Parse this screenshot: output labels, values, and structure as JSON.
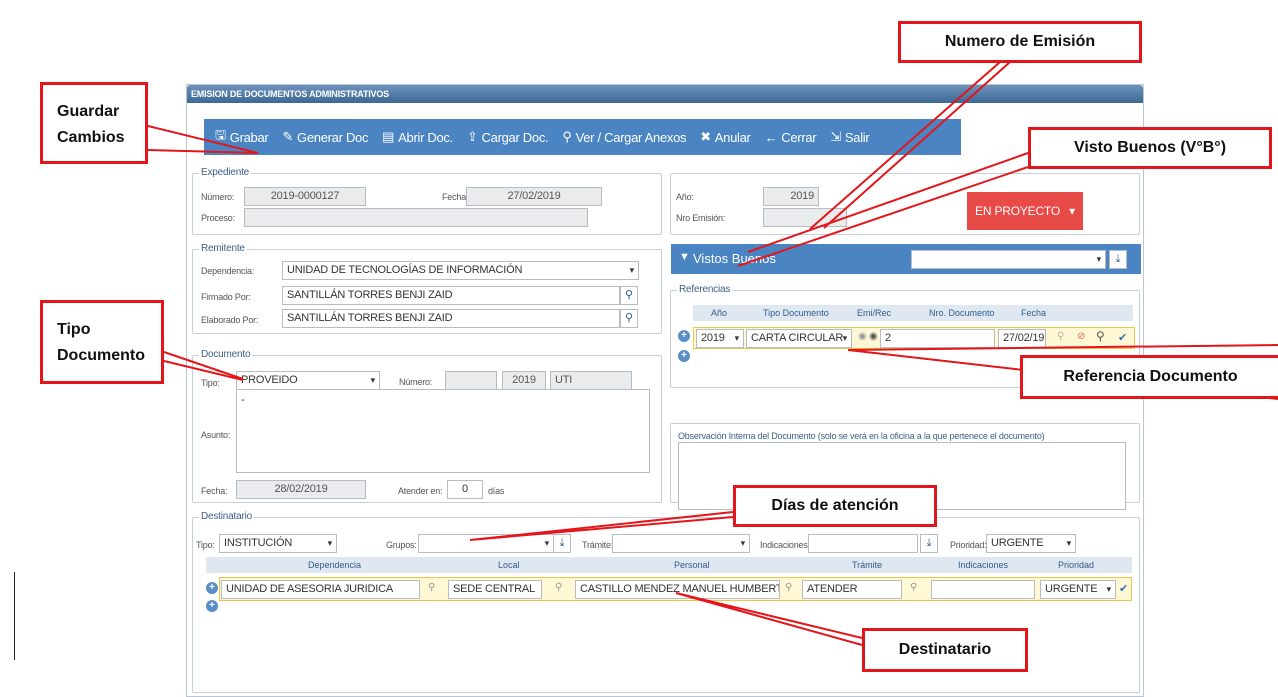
{
  "window_title": "EMISION DE DOCUMENTOS ADMINISTRATIVOS",
  "toolbar": [
    {
      "icon": "save-icon",
      "glyph": "🖫",
      "label": "Grabar"
    },
    {
      "icon": "edit-icon",
      "glyph": "✎",
      "label": "Generar Doc"
    },
    {
      "icon": "document-icon",
      "glyph": "▤",
      "label": "Abrir Doc."
    },
    {
      "icon": "upload-icon",
      "glyph": "⇪",
      "label": "Cargar Doc."
    },
    {
      "icon": "paperclip-icon",
      "glyph": "⚲",
      "label": "Ver / Cargar Anexos"
    },
    {
      "icon": "close-icon",
      "glyph": "✖",
      "label": "Anular"
    },
    {
      "icon": "arrow-left-icon",
      "glyph": "←",
      "label": "Cerrar"
    },
    {
      "icon": "exit-icon",
      "glyph": "⇲",
      "label": "Salir"
    }
  ],
  "expediente": {
    "legend": "Expediente",
    "numero_label": "Número:",
    "numero": "2019-0000127",
    "fecha_label": "Fecha:",
    "fecha": "27/02/2019",
    "proceso_label": "Proceso:",
    "proceso": ""
  },
  "emision": {
    "anio_label": "Año:",
    "anio": "2019",
    "nro_label": "Nro Emisión:",
    "nro": "",
    "estado": "EN PROYECTO"
  },
  "remitente": {
    "legend": "Remitente",
    "dependencia_label": "Dependencia:",
    "dependencia": "UNIDAD DE TECNOLOGÍAS DE INFORMACIÓN",
    "firmado_label": "Firmado Por:",
    "firmado": "SANTILLÁN TORRES BENJI ZAID",
    "elaborado_label": "Elaborado Por:",
    "elaborado": "SANTILLÁN TORRES BENJI ZAID"
  },
  "vistos": {
    "label": "Vistos Buenos",
    "value": ""
  },
  "referencias": {
    "legend": "Referencias",
    "headers": [
      "Año",
      "Tipo Documento",
      "Emi/Rec",
      "Nro. Documento",
      "Fecha"
    ],
    "row": {
      "anio": "2019",
      "tipo": "CARTA CIRCULAR",
      "nro": "2",
      "fecha": "27/02/19"
    }
  },
  "documento": {
    "legend": "Documento",
    "tipo_label": "Tipo:",
    "tipo": "PROVEIDO",
    "numero_label": "Número:",
    "numero": "",
    "anio": "2019",
    "sigla": "UTI",
    "asunto_label": "Asunto:",
    "asunto": "-",
    "fecha_label": "Fecha:",
    "fecha": "28/02/2019",
    "atender_label": "Atender en:",
    "atender": "0",
    "dias_label": "días"
  },
  "observacion": {
    "label": "Observación Interna del Documento (solo se verá en la oficina a la que pertenece el documento)",
    "value": ""
  },
  "destinatario": {
    "legend": "Destinatario",
    "tipo_label": "Tipo:",
    "tipo": "INSTITUCIÓN",
    "grupos_label": "Grupos:",
    "grupos": "",
    "tramite_label": "Trámite:",
    "tramite": "",
    "indicaciones_label": "Indicaciones:",
    "indicaciones": "",
    "prioridad_label": "Prioridad:",
    "prioridad": "URGENTE",
    "headers": [
      "Dependencia",
      "Local",
      "Personal",
      "Trámite",
      "Indicaciones",
      "Prioridad"
    ],
    "row": {
      "dependencia": "UNIDAD DE ASESORIA JURIDICA",
      "local": "SEDE CENTRAL",
      "personal": "CASTILLO MENDEZ MANUEL HUMBERTO",
      "tramite": "ATENDER",
      "indicaciones": "",
      "prioridad": "URGENTE"
    }
  },
  "annotations": {
    "guardar": "Guardar Cambios",
    "numero": "Numero de Emisión",
    "visto": "Visto Buenos (V°B°)",
    "tipo": "Tipo Documento",
    "referencia": "Referencia Documento",
    "dias": "Días de atención",
    "destinatario": "Destinatario"
  },
  "colors": {
    "annotation": "#e3161b",
    "toolbar": "#4a84c2",
    "estado": "#e84a47"
  }
}
